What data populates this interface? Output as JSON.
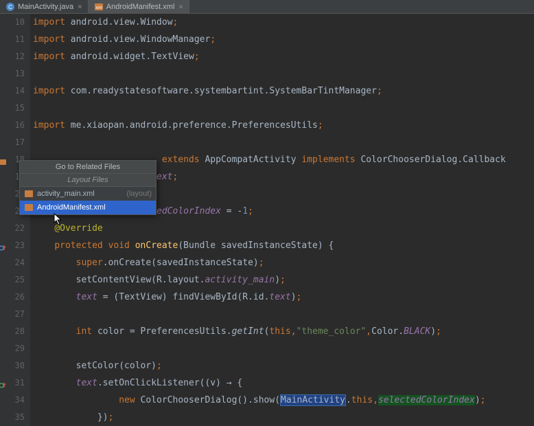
{
  "tabs": [
    {
      "label": "MainActivity.java",
      "active": false,
      "icon": "java"
    },
    {
      "label": "AndroidManifest.xml",
      "active": true,
      "icon": "xml"
    }
  ],
  "popup": {
    "title": "Go to Related Files",
    "section": "Layout Files",
    "items": [
      {
        "label": "activity_main.xml",
        "hint": "(layout)",
        "selected": false
      },
      {
        "label": "AndroidManifest.xml",
        "hint": "",
        "selected": true
      }
    ]
  },
  "gutter_start": 10,
  "lines": [
    {
      "n": 10,
      "tokens": [
        [
          "kw",
          "import "
        ],
        [
          "pkg",
          "android"
        ],
        [
          "op",
          "."
        ],
        [
          "pkg",
          "view"
        ],
        [
          "op",
          "."
        ],
        [
          "cls",
          "Window"
        ],
        [
          "sc",
          ";"
        ]
      ]
    },
    {
      "n": 11,
      "tokens": [
        [
          "kw",
          "import "
        ],
        [
          "pkg",
          "android"
        ],
        [
          "op",
          "."
        ],
        [
          "pkg",
          "view"
        ],
        [
          "op",
          "."
        ],
        [
          "cls",
          "WindowManager"
        ],
        [
          "sc",
          ";"
        ]
      ]
    },
    {
      "n": 12,
      "tokens": [
        [
          "kw",
          "import "
        ],
        [
          "pkg",
          "android"
        ],
        [
          "op",
          "."
        ],
        [
          "pkg",
          "widget"
        ],
        [
          "op",
          "."
        ],
        [
          "cls",
          "TextView"
        ],
        [
          "sc",
          ";"
        ]
      ]
    },
    {
      "n": 13,
      "tokens": []
    },
    {
      "n": 14,
      "tokens": [
        [
          "kw",
          "import "
        ],
        [
          "pkg",
          "com"
        ],
        [
          "op",
          "."
        ],
        [
          "pkg",
          "readystatesoftware"
        ],
        [
          "op",
          "."
        ],
        [
          "pkg",
          "systembartint"
        ],
        [
          "op",
          "."
        ],
        [
          "cls",
          "SystemBarTintManager"
        ],
        [
          "sc",
          ";"
        ]
      ]
    },
    {
      "n": 15,
      "tokens": []
    },
    {
      "n": 16,
      "tokens": [
        [
          "kw",
          "import "
        ],
        [
          "pkg",
          "me"
        ],
        [
          "op",
          "."
        ],
        [
          "pkg",
          "xiaopan"
        ],
        [
          "op",
          "."
        ],
        [
          "pkg",
          "android"
        ],
        [
          "op",
          "."
        ],
        [
          "pkg",
          "preference"
        ],
        [
          "op",
          "."
        ],
        [
          "cls",
          "PreferencesUtils"
        ],
        [
          "sc",
          ";"
        ]
      ]
    },
    {
      "n": 17,
      "tokens": []
    },
    {
      "n": 18,
      "marker": "related",
      "tokens": [
        [
          "txt",
          "                        "
        ],
        [
          "kw",
          "extends "
        ],
        [
          "cls",
          "AppCompatActivity "
        ],
        [
          "kw",
          "implements "
        ],
        [
          "cls",
          "ColorChooserDialog"
        ],
        [
          "op",
          "."
        ],
        [
          "cls",
          "Callback"
        ]
      ]
    },
    {
      "n": 19,
      "tokens": [
        [
          "txt",
          "                       "
        ],
        [
          "fld",
          "ext"
        ],
        [
          "sc",
          ";"
        ]
      ]
    },
    {
      "n": 20,
      "tokens": []
    },
    {
      "n": 21,
      "tokens": [
        [
          "txt",
          "                       "
        ],
        [
          "fld",
          "edColorIndex"
        ],
        [
          "op",
          " = "
        ],
        [
          "op",
          "-"
        ],
        [
          "num",
          "1"
        ],
        [
          "sc",
          ";"
        ]
      ]
    },
    {
      "n": 22,
      "tokens": [
        [
          "txt",
          "    "
        ],
        [
          "ann",
          "@Override"
        ]
      ]
    },
    {
      "n": 23,
      "marker": "override",
      "tokens": [
        [
          "txt",
          "    "
        ],
        [
          "kw",
          "protected void "
        ],
        [
          "fn",
          "onCreate"
        ],
        [
          "op",
          "("
        ],
        [
          "cls",
          "Bundle "
        ],
        [
          "param",
          "savedInstanceState"
        ],
        [
          "op",
          ") {"
        ]
      ]
    },
    {
      "n": 24,
      "tokens": [
        [
          "txt",
          "        "
        ],
        [
          "kw",
          "super"
        ],
        [
          "op",
          "."
        ],
        [
          "txt",
          "onCreate(savedInstanceState)"
        ],
        [
          "sc",
          ";"
        ]
      ]
    },
    {
      "n": 25,
      "tokens": [
        [
          "txt",
          "        setContentView(R.layout."
        ],
        [
          "fld",
          "activity_main"
        ],
        [
          "op",
          ")"
        ],
        [
          "sc",
          ";"
        ]
      ]
    },
    {
      "n": 26,
      "tokens": [
        [
          "txt",
          "        "
        ],
        [
          "fld",
          "text"
        ],
        [
          "op",
          " = (TextView) findViewById(R.id."
        ],
        [
          "fld",
          "text"
        ],
        [
          "op",
          ")"
        ],
        [
          "sc",
          ";"
        ]
      ]
    },
    {
      "n": 27,
      "tokens": []
    },
    {
      "n": 28,
      "tokens": [
        [
          "txt",
          "        "
        ],
        [
          "kw",
          "int "
        ],
        [
          "txt",
          "color = PreferencesUtils."
        ],
        [
          "stc",
          "getInt"
        ],
        [
          "op",
          "("
        ],
        [
          "kw",
          "this"
        ],
        [
          "sc",
          ","
        ],
        [
          "str",
          "\"theme_color\""
        ],
        [
          "sc",
          ","
        ],
        [
          "txt",
          "Color."
        ],
        [
          "fld",
          "BLACK"
        ],
        [
          "op",
          ")"
        ],
        [
          "sc",
          ";"
        ]
      ]
    },
    {
      "n": 29,
      "tokens": []
    },
    {
      "n": 30,
      "tokens": [
        [
          "txt",
          "        setColor(color)"
        ],
        [
          "sc",
          ";"
        ]
      ]
    },
    {
      "n": 31,
      "marker": "impl",
      "tokens": [
        [
          "txt",
          "        "
        ],
        [
          "fld",
          "text"
        ],
        [
          "op",
          ".setOnClickListener((v) "
        ],
        [
          "op",
          "→"
        ],
        [
          "op",
          " {"
        ]
      ]
    },
    {
      "n": 34,
      "tokens": [
        [
          "txt",
          "                "
        ],
        [
          "kw",
          "new "
        ],
        [
          "txt",
          "ColorChooserDialog().show("
        ],
        [
          "hlbox",
          "MainActivity"
        ],
        [
          "op",
          "."
        ],
        [
          "kw",
          "this"
        ],
        [
          "sc",
          ","
        ],
        [
          "hlsel",
          "selectedColorIndex"
        ],
        [
          "op",
          ")"
        ],
        [
          "sc",
          ";"
        ]
      ]
    },
    {
      "n": 35,
      "tokens": [
        [
          "txt",
          "            })"
        ],
        [
          "sc",
          ";"
        ]
      ]
    }
  ]
}
